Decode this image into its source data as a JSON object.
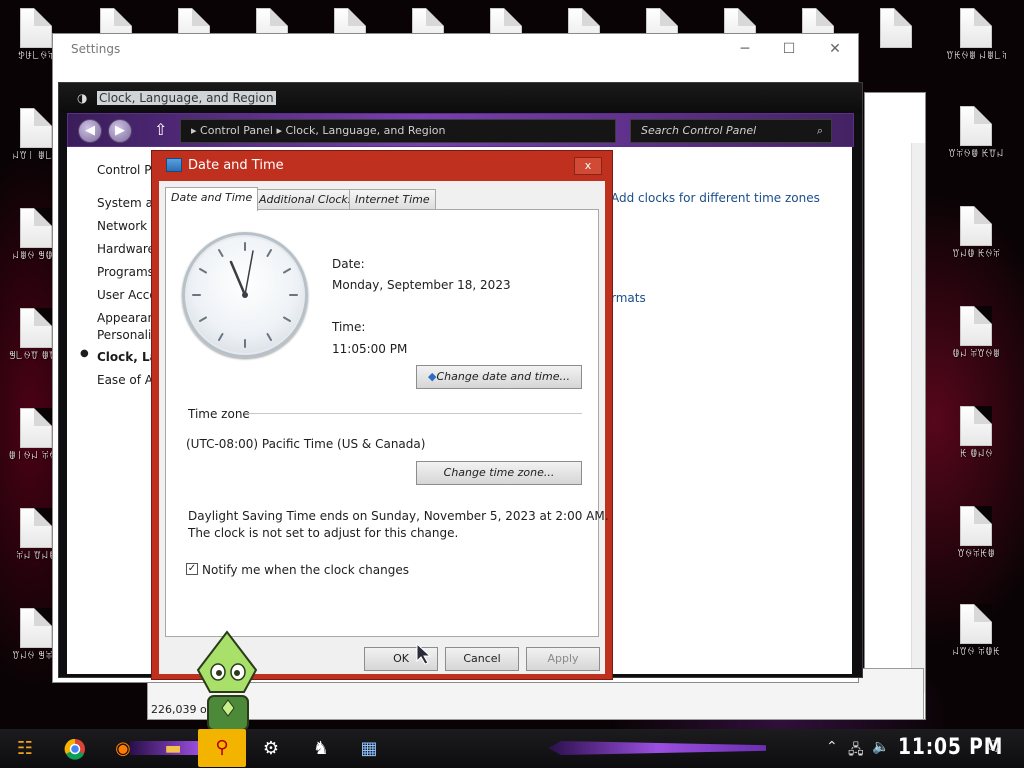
{
  "desktop": {
    "left_icons": [
      {
        "label": "ꉣꀰ꒒ꍈꋖ"
      },
      {
        "label": "ꈤꀎ꒐\nꂦ꒒ꋖ"
      },
      {
        "label": "ꈤꂦꍈ\nꁅꂦꋖ"
      },
      {
        "label": "ꁅ꒒ꍈꀎ\nꂦꀎꋖ"
      },
      {
        "label": "ꂦ꒐ꍈꈤ\nꋖꍈꀘ"
      },
      {
        "label": "ꋖꈤ\nꀎꈤꂦ"
      },
      {
        "label": "ꀎꈤꍈ\nꁅꋖꂦ"
      }
    ],
    "right_icons": [
      {
        "label": "ꀎꀘꍈꂦ\nꈤꂦ꒒ꋖ"
      },
      {
        "label": "ꀎꋖꍈꂦ\nꀘꀎꈤ"
      },
      {
        "label": "ꀎꈤꂦ\nꀘꍈꋖ"
      },
      {
        "label": "ꂦꈤ\nꋖꀎꍈꂦ"
      },
      {
        "label": "ꀘ\nꂦꈤꍈ"
      },
      {
        "label": "ꀎꍈꋖꀘꂦ"
      },
      {
        "label": "ꈤꀎꍈ\nꋖꂦꀘ"
      }
    ]
  },
  "settings_window": {
    "title": "Settings"
  },
  "control_panel": {
    "title": "Clock, Language, and Region",
    "breadcrumb": {
      "root": "Control Panel",
      "current": "Clock, Language, and Region"
    },
    "search_placeholder": "Search Control Panel",
    "sidebar": [
      "Control Pa",
      "System ar",
      "Network a",
      "Hardware",
      "Programs",
      "User Acco",
      "Appearanc",
      "Personaliz",
      "Clock, Lan",
      "Ease of A"
    ],
    "links": {
      "add_clocks": "Add clocks for different time zones",
      "formats": "rmats"
    }
  },
  "explorer": {
    "status": "226,039 obje"
  },
  "dialog": {
    "title": "Date and Time",
    "close": "x",
    "tabs": [
      "Date and Time",
      "Additional Clocks",
      "Internet Time"
    ],
    "date_label": "Date:",
    "date_value": "Monday, September 18, 2023",
    "time_label": "Time:",
    "time_value": "11:05:00 PM",
    "change_date_button": "Change date and time...",
    "timezone_heading": "Time zone",
    "timezone_value": "(UTC-08:00) Pacific Time (US & Canada)",
    "change_timezone_button": "Change time zone...",
    "dst_line1": "Daylight Saving Time ends on Sunday, November 5, 2023 at 2:00 AM.",
    "dst_line2": "The clock is not set to adjust for this change.",
    "notify_label": "Notify me when the clock changes",
    "notify_checked": true,
    "ok": "OK",
    "cancel": "Cancel",
    "apply": "Apply"
  },
  "taskbar": {
    "clock": "11:05 PM",
    "accent": "#9b4fe0"
  }
}
